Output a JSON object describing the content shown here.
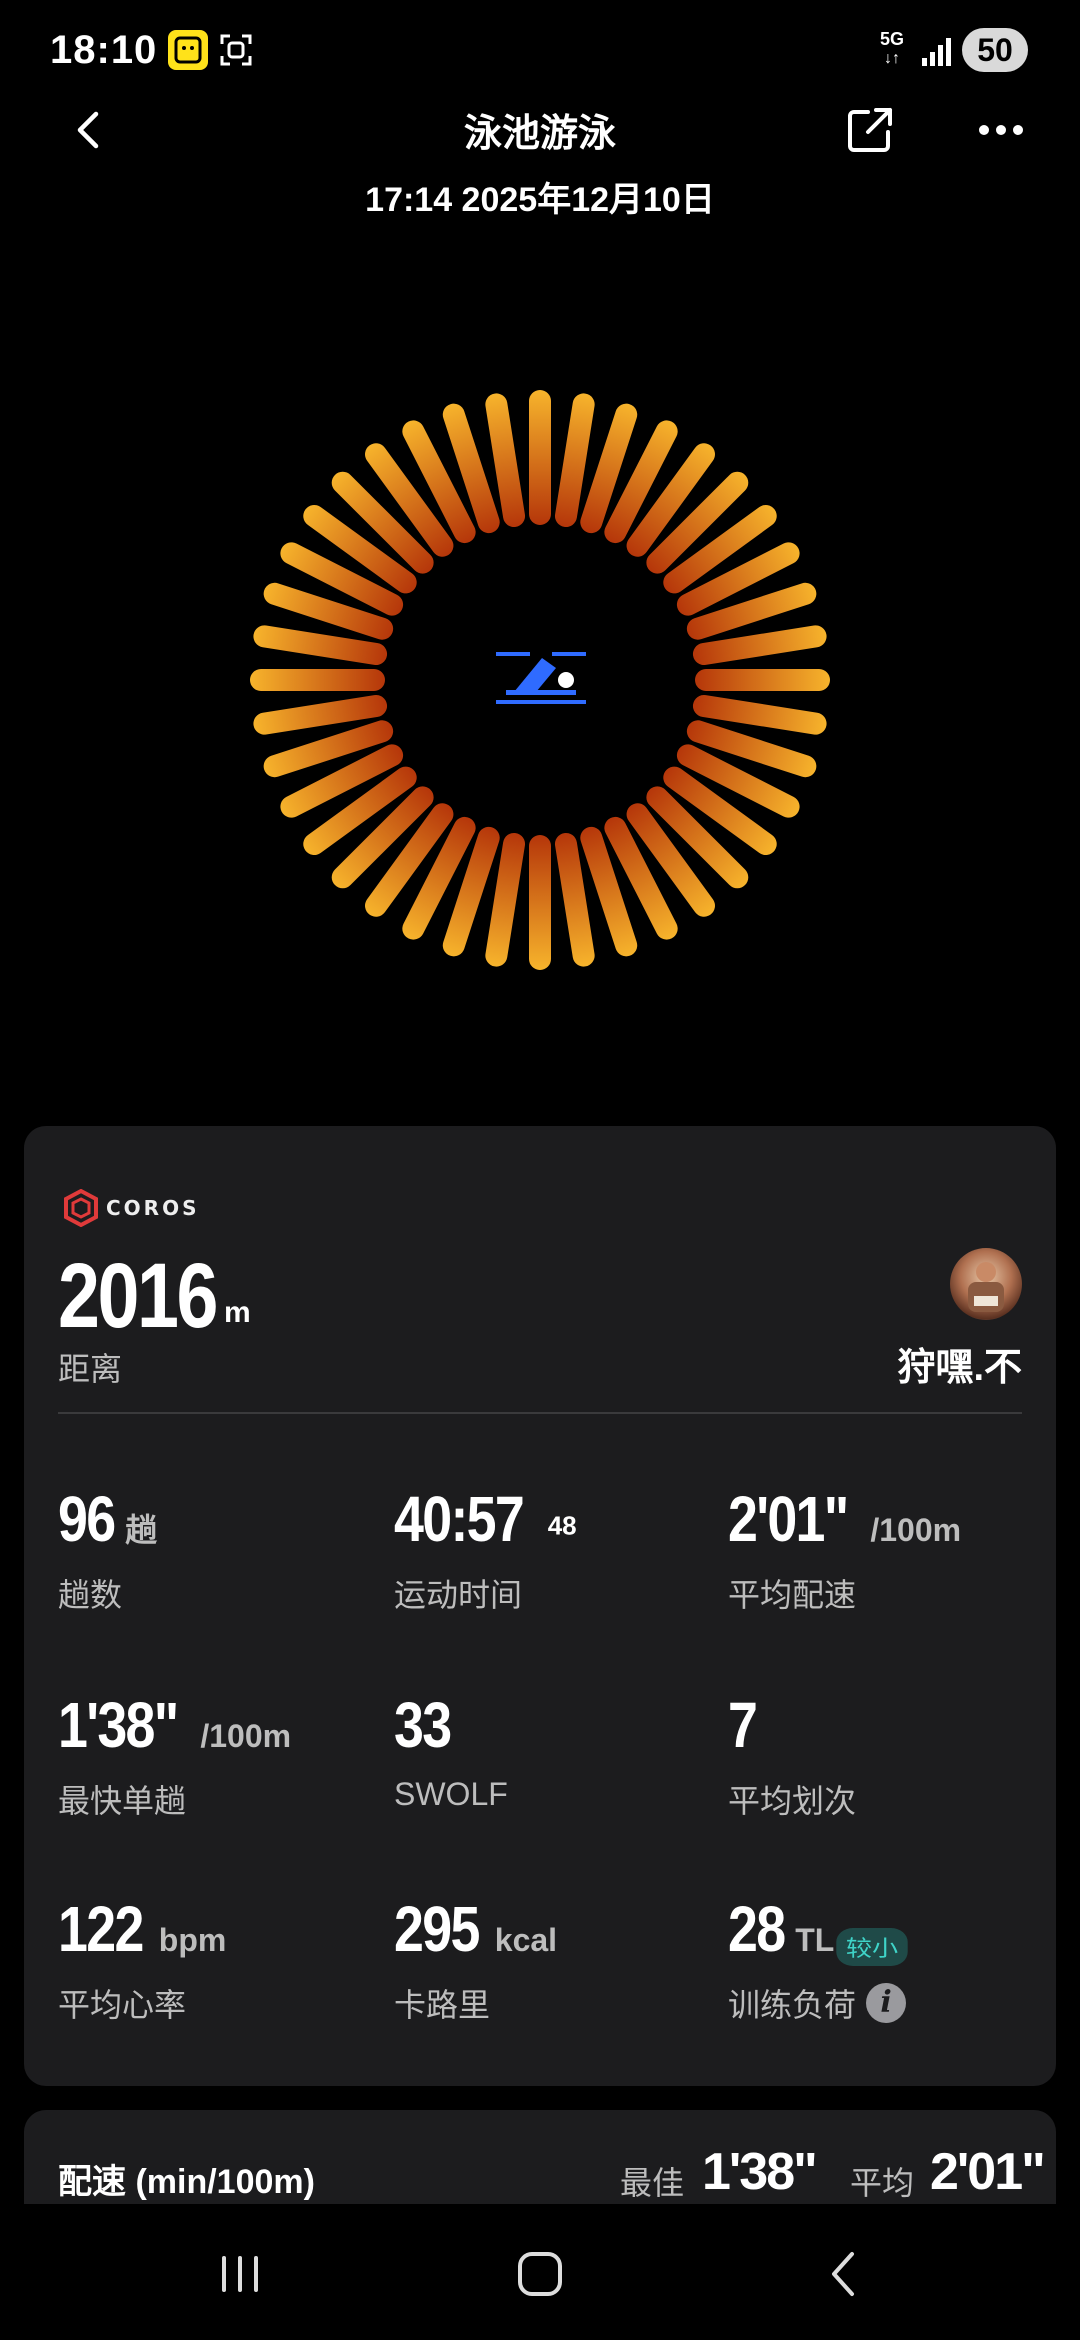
{
  "status_bar": {
    "time": "18:10",
    "network": "5G",
    "battery": "50",
    "icons": [
      "app-icon",
      "scan-icon",
      "signal-icon"
    ]
  },
  "header": {
    "title": "泳池游泳",
    "datetime": "17:14 2025年12月10日"
  },
  "ring": {
    "center_icon": "swimmer-icon",
    "colors": [
      "#f5a623",
      "#c0390b"
    ]
  },
  "card": {
    "brand": "COROS",
    "distance": {
      "value": "2016",
      "unit": "m",
      "label": "距离"
    },
    "user": {
      "name": "狩嘿.不"
    },
    "stats": [
      {
        "value": "96",
        "unit": "趟",
        "label": "趟数"
      },
      {
        "value": "40:57",
        "sup": "48",
        "label": "运动时间"
      },
      {
        "value": "2'01\"",
        "unit": "/100m",
        "label": "平均配速"
      },
      {
        "value": "1'38\"",
        "unit": "/100m",
        "label": "最快单趟"
      },
      {
        "value": "33",
        "label": "SWOLF"
      },
      {
        "value": "7",
        "label": "平均划次"
      },
      {
        "value": "122",
        "unit": "bpm",
        "label": "平均心率"
      },
      {
        "value": "295",
        "unit": "kcal",
        "label": "卡路里"
      },
      {
        "value": "28",
        "unit": "TL",
        "tag": "较小",
        "label": "训练负荷",
        "info": "i"
      }
    ]
  },
  "pace_card": {
    "title": "配速 (min/100m)",
    "best_label": "最佳",
    "best_value": "1'38\"",
    "avg_label": "平均",
    "avg_value": "2'01\""
  },
  "nav": {
    "icons": [
      "recent-apps-icon",
      "home-icon",
      "back-icon"
    ]
  }
}
